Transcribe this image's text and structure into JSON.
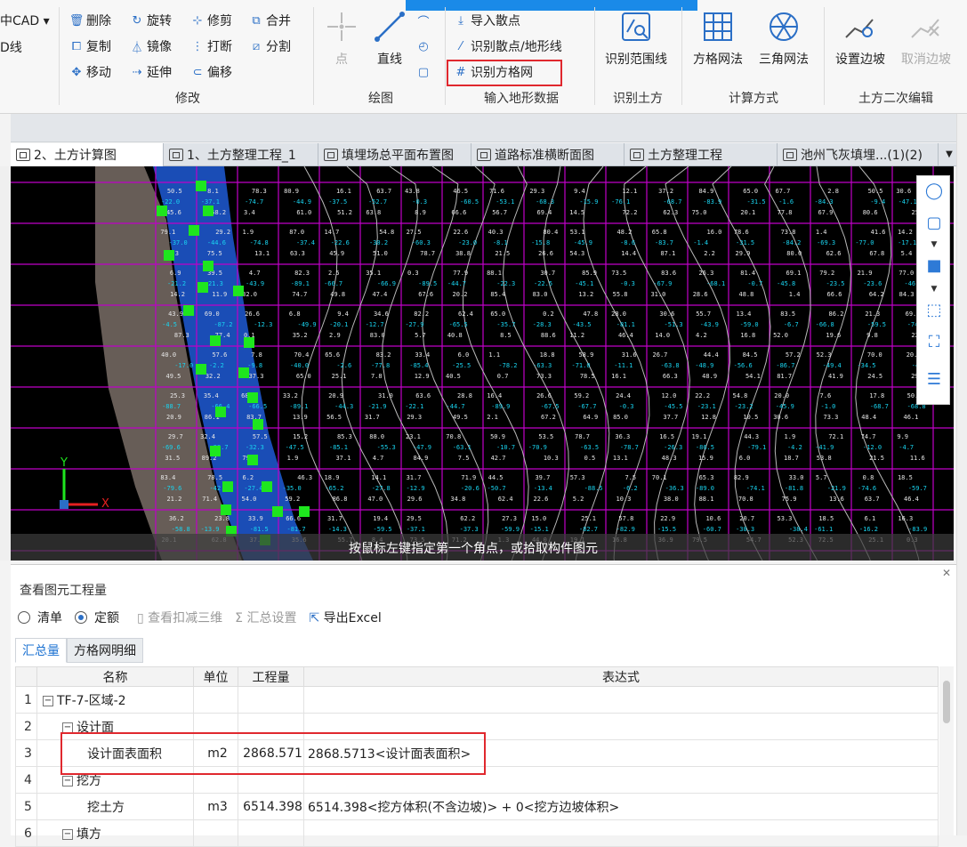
{
  "ribbon": {
    "left_edge": [
      "中CAD ▾",
      "D线"
    ],
    "modify": {
      "title": "修改",
      "buttons": [
        {
          "label": "删除",
          "icon": "trash-icon"
        },
        {
          "label": "旋转",
          "icon": "rotate-icon"
        },
        {
          "label": "修剪",
          "icon": "trim-icon"
        },
        {
          "label": "合并",
          "icon": "merge-icon"
        },
        {
          "label": "复制",
          "icon": "copy-icon"
        },
        {
          "label": "镜像",
          "icon": "mirror-icon"
        },
        {
          "label": "打断",
          "icon": "break-icon"
        },
        {
          "label": "分割",
          "icon": "split-icon"
        },
        {
          "label": "移动",
          "icon": "move-icon"
        },
        {
          "label": "延伸",
          "icon": "extend-icon"
        },
        {
          "label": "偏移",
          "icon": "offset-icon"
        }
      ]
    },
    "draw": {
      "title": "绘图",
      "point_label": "点",
      "line_label": "直线"
    },
    "terrain": {
      "title": "输入地形数据",
      "import_points": "导入散点",
      "identify_points": "识别散点/地形线",
      "identify_grid": "识别方格网"
    },
    "earthwork": {
      "title": "识别土方",
      "identify_range": "识别范围线"
    },
    "calc": {
      "title": "计算方式",
      "grid_method": "方格网法",
      "triangle_method": "三角网法"
    },
    "secondary": {
      "title": "土方二次编辑",
      "set_slope": "设置边坡",
      "cancel_slope": "取消边坡"
    }
  },
  "tabs": [
    {
      "label": "2、土方计算图",
      "active": true
    },
    {
      "label": "1、土方整理工程_1",
      "active": false
    },
    {
      "label": "填埋场总平面布置图",
      "active": false
    },
    {
      "label": "道路标准横断面图",
      "active": false
    },
    {
      "label": "土方整理工程",
      "active": false
    },
    {
      "label": "池州飞灰填埋...(1)(2)",
      "active": false
    }
  ],
  "canvas": {
    "command_prompt": "按鼠标左键指定第一个角点，或拾取构件图元",
    "axis_x": "X",
    "axis_y": "Y"
  },
  "panel": {
    "title": "查看图元工程量",
    "options": {
      "list": "清单",
      "quota": "定额",
      "quota_selected": true
    },
    "actions": {
      "view_3d": "查看扣减三维",
      "summary_settings": "汇总设置",
      "export": "导出Excel"
    },
    "subtabs": {
      "summary": "汇总量",
      "grid_detail": "方格网明细"
    },
    "columns": {
      "name": "名称",
      "unit": "单位",
      "qty": "工程量",
      "expr": "表达式"
    },
    "rows": [
      {
        "no": "1",
        "name": "TF-7-区域-2",
        "unit": "",
        "qty": "",
        "expr": "",
        "level": 0,
        "toggle": "−"
      },
      {
        "no": "2",
        "name": "设计面",
        "unit": "",
        "qty": "",
        "expr": "",
        "level": 1,
        "toggle": "−"
      },
      {
        "no": "3",
        "name": "设计面表面积",
        "unit": "m2",
        "qty": "2868.571",
        "expr": "2868.5713<设计面表面积>",
        "level": 2,
        "toggle": ""
      },
      {
        "no": "4",
        "name": "挖方",
        "unit": "",
        "qty": "",
        "expr": "",
        "level": 1,
        "toggle": "−"
      },
      {
        "no": "5",
        "name": "挖土方",
        "unit": "m3",
        "qty": "6514.398",
        "expr": "6514.398<挖方体积(不含边坡)> + 0<挖方边坡体积>",
        "level": 2,
        "toggle": ""
      },
      {
        "no": "6",
        "name": "填方",
        "unit": "",
        "qty": "",
        "expr": "",
        "level": 1,
        "toggle": "−"
      }
    ]
  },
  "colors": {
    "accent": "#1a8ae8",
    "highlight": "#e0282e",
    "grid_line": "#c000c8",
    "pad": "#1f5bd6",
    "marker": "#1ee61e"
  }
}
